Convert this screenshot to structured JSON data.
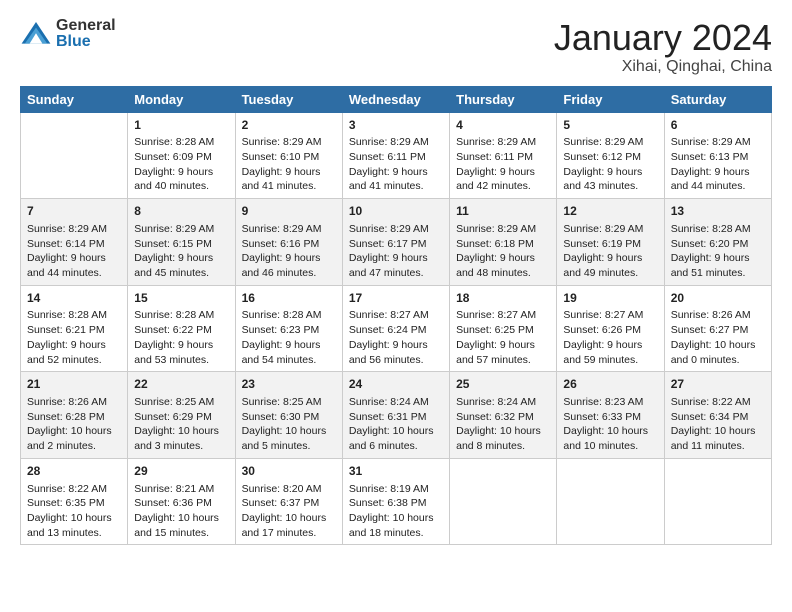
{
  "header": {
    "logo_general": "General",
    "logo_blue": "Blue",
    "month_title": "January 2024",
    "location": "Xihai, Qinghai, China"
  },
  "days_of_week": [
    "Sunday",
    "Monday",
    "Tuesday",
    "Wednesday",
    "Thursday",
    "Friday",
    "Saturday"
  ],
  "weeks": [
    [
      {
        "day": "",
        "info": ""
      },
      {
        "day": "1",
        "info": "Sunrise: 8:28 AM\nSunset: 6:09 PM\nDaylight: 9 hours\nand 40 minutes."
      },
      {
        "day": "2",
        "info": "Sunrise: 8:29 AM\nSunset: 6:10 PM\nDaylight: 9 hours\nand 41 minutes."
      },
      {
        "day": "3",
        "info": "Sunrise: 8:29 AM\nSunset: 6:11 PM\nDaylight: 9 hours\nand 41 minutes."
      },
      {
        "day": "4",
        "info": "Sunrise: 8:29 AM\nSunset: 6:11 PM\nDaylight: 9 hours\nand 42 minutes."
      },
      {
        "day": "5",
        "info": "Sunrise: 8:29 AM\nSunset: 6:12 PM\nDaylight: 9 hours\nand 43 minutes."
      },
      {
        "day": "6",
        "info": "Sunrise: 8:29 AM\nSunset: 6:13 PM\nDaylight: 9 hours\nand 44 minutes."
      }
    ],
    [
      {
        "day": "7",
        "info": "Sunrise: 8:29 AM\nSunset: 6:14 PM\nDaylight: 9 hours\nand 44 minutes."
      },
      {
        "day": "8",
        "info": "Sunrise: 8:29 AM\nSunset: 6:15 PM\nDaylight: 9 hours\nand 45 minutes."
      },
      {
        "day": "9",
        "info": "Sunrise: 8:29 AM\nSunset: 6:16 PM\nDaylight: 9 hours\nand 46 minutes."
      },
      {
        "day": "10",
        "info": "Sunrise: 8:29 AM\nSunset: 6:17 PM\nDaylight: 9 hours\nand 47 minutes."
      },
      {
        "day": "11",
        "info": "Sunrise: 8:29 AM\nSunset: 6:18 PM\nDaylight: 9 hours\nand 48 minutes."
      },
      {
        "day": "12",
        "info": "Sunrise: 8:29 AM\nSunset: 6:19 PM\nDaylight: 9 hours\nand 49 minutes."
      },
      {
        "day": "13",
        "info": "Sunrise: 8:28 AM\nSunset: 6:20 PM\nDaylight: 9 hours\nand 51 minutes."
      }
    ],
    [
      {
        "day": "14",
        "info": "Sunrise: 8:28 AM\nSunset: 6:21 PM\nDaylight: 9 hours\nand 52 minutes."
      },
      {
        "day": "15",
        "info": "Sunrise: 8:28 AM\nSunset: 6:22 PM\nDaylight: 9 hours\nand 53 minutes."
      },
      {
        "day": "16",
        "info": "Sunrise: 8:28 AM\nSunset: 6:23 PM\nDaylight: 9 hours\nand 54 minutes."
      },
      {
        "day": "17",
        "info": "Sunrise: 8:27 AM\nSunset: 6:24 PM\nDaylight: 9 hours\nand 56 minutes."
      },
      {
        "day": "18",
        "info": "Sunrise: 8:27 AM\nSunset: 6:25 PM\nDaylight: 9 hours\nand 57 minutes."
      },
      {
        "day": "19",
        "info": "Sunrise: 8:27 AM\nSunset: 6:26 PM\nDaylight: 9 hours\nand 59 minutes."
      },
      {
        "day": "20",
        "info": "Sunrise: 8:26 AM\nSunset: 6:27 PM\nDaylight: 10 hours\nand 0 minutes."
      }
    ],
    [
      {
        "day": "21",
        "info": "Sunrise: 8:26 AM\nSunset: 6:28 PM\nDaylight: 10 hours\nand 2 minutes."
      },
      {
        "day": "22",
        "info": "Sunrise: 8:25 AM\nSunset: 6:29 PM\nDaylight: 10 hours\nand 3 minutes."
      },
      {
        "day": "23",
        "info": "Sunrise: 8:25 AM\nSunset: 6:30 PM\nDaylight: 10 hours\nand 5 minutes."
      },
      {
        "day": "24",
        "info": "Sunrise: 8:24 AM\nSunset: 6:31 PM\nDaylight: 10 hours\nand 6 minutes."
      },
      {
        "day": "25",
        "info": "Sunrise: 8:24 AM\nSunset: 6:32 PM\nDaylight: 10 hours\nand 8 minutes."
      },
      {
        "day": "26",
        "info": "Sunrise: 8:23 AM\nSunset: 6:33 PM\nDaylight: 10 hours\nand 10 minutes."
      },
      {
        "day": "27",
        "info": "Sunrise: 8:22 AM\nSunset: 6:34 PM\nDaylight: 10 hours\nand 11 minutes."
      }
    ],
    [
      {
        "day": "28",
        "info": "Sunrise: 8:22 AM\nSunset: 6:35 PM\nDaylight: 10 hours\nand 13 minutes."
      },
      {
        "day": "29",
        "info": "Sunrise: 8:21 AM\nSunset: 6:36 PM\nDaylight: 10 hours\nand 15 minutes."
      },
      {
        "day": "30",
        "info": "Sunrise: 8:20 AM\nSunset: 6:37 PM\nDaylight: 10 hours\nand 17 minutes."
      },
      {
        "day": "31",
        "info": "Sunrise: 8:19 AM\nSunset: 6:38 PM\nDaylight: 10 hours\nand 18 minutes."
      },
      {
        "day": "",
        "info": ""
      },
      {
        "day": "",
        "info": ""
      },
      {
        "day": "",
        "info": ""
      }
    ]
  ]
}
